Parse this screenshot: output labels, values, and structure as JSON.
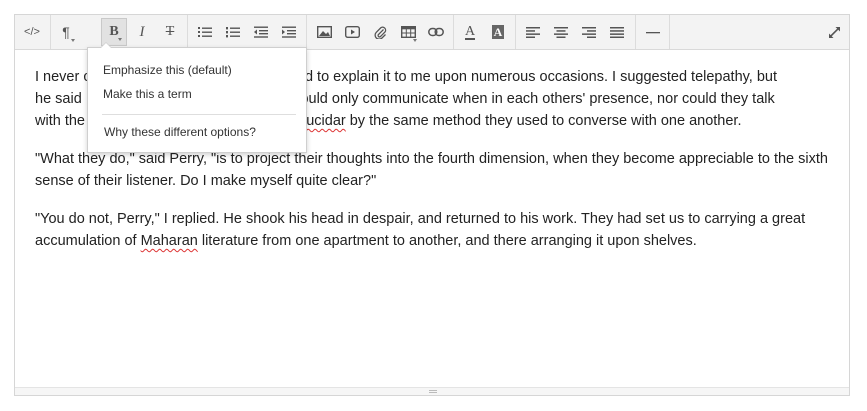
{
  "toolbar": {
    "buttons": [
      {
        "name": "code-view-button",
        "icon": "code-icon",
        "glyph": "</>"
      },
      {
        "name": "paragraph-format-button",
        "icon": "pilcrow-icon",
        "glyph": "¶"
      },
      {
        "name": "bold-button",
        "icon": "bold-icon",
        "glyph": "B",
        "active": true
      },
      {
        "name": "italic-button",
        "icon": "italic-icon",
        "glyph": "I"
      },
      {
        "name": "strikethrough-button",
        "icon": "strikethrough-icon",
        "glyph": "T"
      },
      {
        "name": "bullet-list-button",
        "icon": "bullet-list-icon"
      },
      {
        "name": "numbered-list-button",
        "icon": "numbered-list-icon"
      },
      {
        "name": "outdent-button",
        "icon": "outdent-icon"
      },
      {
        "name": "indent-button",
        "icon": "indent-icon"
      },
      {
        "name": "insert-image-button",
        "icon": "image-icon"
      },
      {
        "name": "insert-video-button",
        "icon": "video-icon"
      },
      {
        "name": "attach-file-button",
        "icon": "paperclip-icon"
      },
      {
        "name": "insert-table-button",
        "icon": "table-icon"
      },
      {
        "name": "insert-link-button",
        "icon": "link-icon"
      },
      {
        "name": "text-color-button",
        "icon": "text-color-icon",
        "glyph": "A"
      },
      {
        "name": "background-color-button",
        "icon": "background-color-icon",
        "glyph": "A"
      },
      {
        "name": "align-left-button",
        "icon": "align-left-icon"
      },
      {
        "name": "align-center-button",
        "icon": "align-center-icon"
      },
      {
        "name": "align-right-button",
        "icon": "align-right-icon"
      },
      {
        "name": "align-justify-button",
        "icon": "align-justify-icon"
      },
      {
        "name": "horizontal-rule-button",
        "icon": "horizontal-rule-icon"
      },
      {
        "name": "fullscreen-button",
        "icon": "expand-icon"
      }
    ]
  },
  "dropdown": {
    "item1": "Emphasize this (default)",
    "item2": "Make this a term",
    "item3": "Why these different options?"
  },
  "content": {
    "p1_a": "I never c",
    "p1_b": "eavored to explain it to me upon numerous occasions. I suggested telepathy, but",
    "p1_c": "he said",
    "p1_d": "they could only communicate when in each others' presence, nor could they talk",
    "p1_e": "with the",
    "p1_f": "f ",
    "p1_spell": "Pellucidar",
    "p1_g": " by the same method they used to converse with one another.",
    "p2": "\"What they do,\" said Perry, \"is to project their thoughts into the fourth dimension, when they become appreciable to the sixth sense of their listener. Do I make myself quite clear?\"",
    "p3_a": "\"You do not, Perry,\" I replied. He shook his head in despair, and returned to his work. They had set us to carrying a great accumulation of ",
    "p3_spell": "Maharan",
    "p3_b": " literature from one apartment to another, and there arranging it upon shelves."
  }
}
